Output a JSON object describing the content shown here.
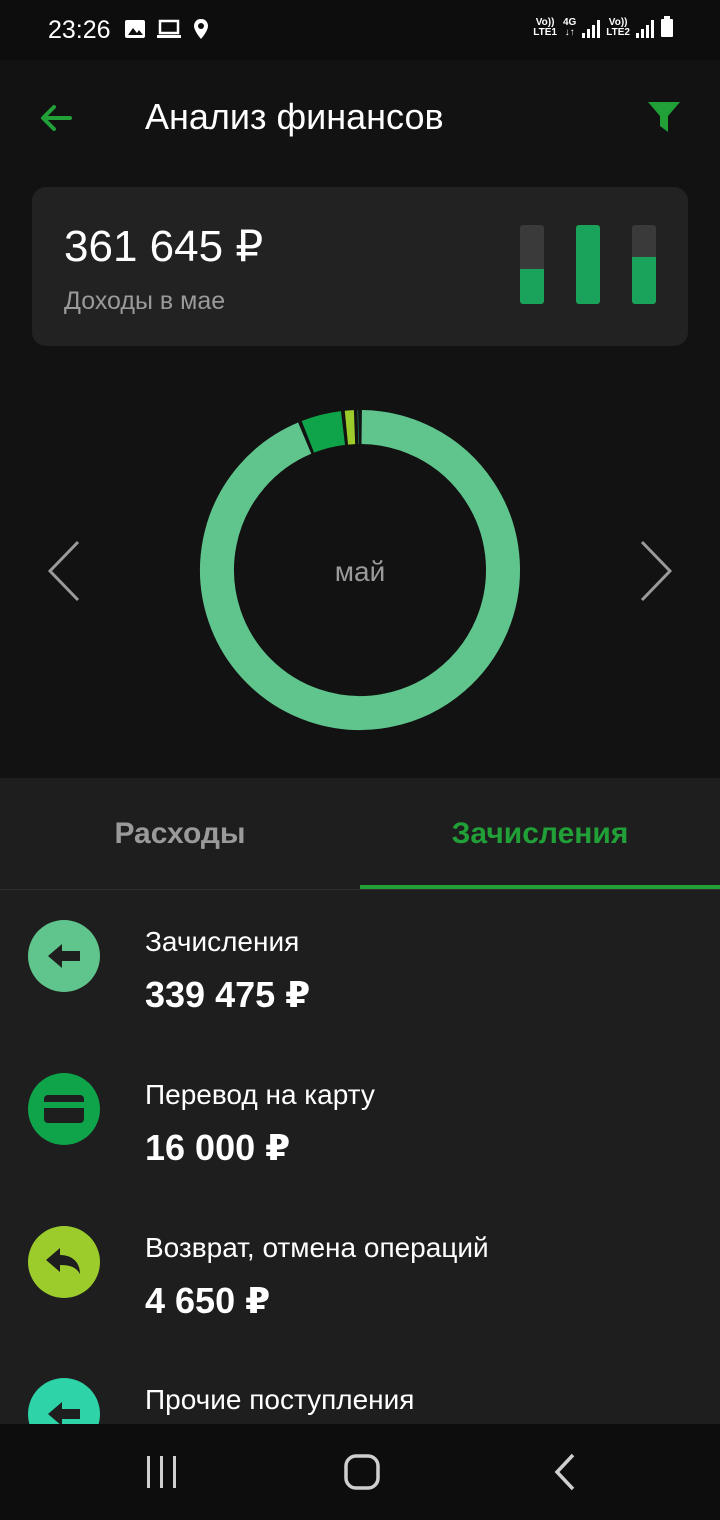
{
  "status_bar": {
    "time": "23:26",
    "icons": [
      "image-icon",
      "laptop-icon",
      "location-icon"
    ],
    "sim1": {
      "top": "Vo))",
      "bottom": "LTE1"
    },
    "net": {
      "top": "4G",
      "bottom": "↓↑"
    },
    "sim2": {
      "top": "Vo))",
      "bottom": "LTE2"
    }
  },
  "header": {
    "title": "Анализ финансов",
    "back_icon": "arrow-left-icon",
    "filter_icon": "filter-icon"
  },
  "summary": {
    "amount": "361 645 ₽",
    "caption": "Доходы в мае",
    "mini_bars_fill": [
      0.44,
      1.0,
      0.6
    ]
  },
  "donut": {
    "center_label": "май",
    "segments": [
      {
        "name": "Зачисления",
        "value": 339475,
        "color": "#5fc58c"
      },
      {
        "name": "Перевод на карту",
        "value": 16000,
        "color": "#0fa34a"
      },
      {
        "name": "Возврат, отмена операций",
        "value": 4650,
        "color": "#9ccc2c"
      },
      {
        "name": "Прочие поступления",
        "value": 1520,
        "color": "#2ed3a8"
      }
    ]
  },
  "tabs": [
    {
      "label": "Расходы",
      "active": false
    },
    {
      "label": "Зачисления",
      "active": true
    }
  ],
  "list": [
    {
      "label": "Зачисления",
      "value": "339 475 ₽",
      "icon": "arrow-in-icon",
      "color": "#5fc58c"
    },
    {
      "label": "Перевод на карту",
      "value": "16 000 ₽",
      "icon": "card-icon",
      "color": "#0fa34a"
    },
    {
      "label": "Возврат, отмена операций",
      "value": "4 650 ₽",
      "icon": "return-icon",
      "color": "#9ccc2c"
    },
    {
      "label": "Прочие поступления",
      "value": "",
      "icon": "arrow-in-icon",
      "color": "#2ed3a8"
    }
  ],
  "accent_color": "#21a038"
}
